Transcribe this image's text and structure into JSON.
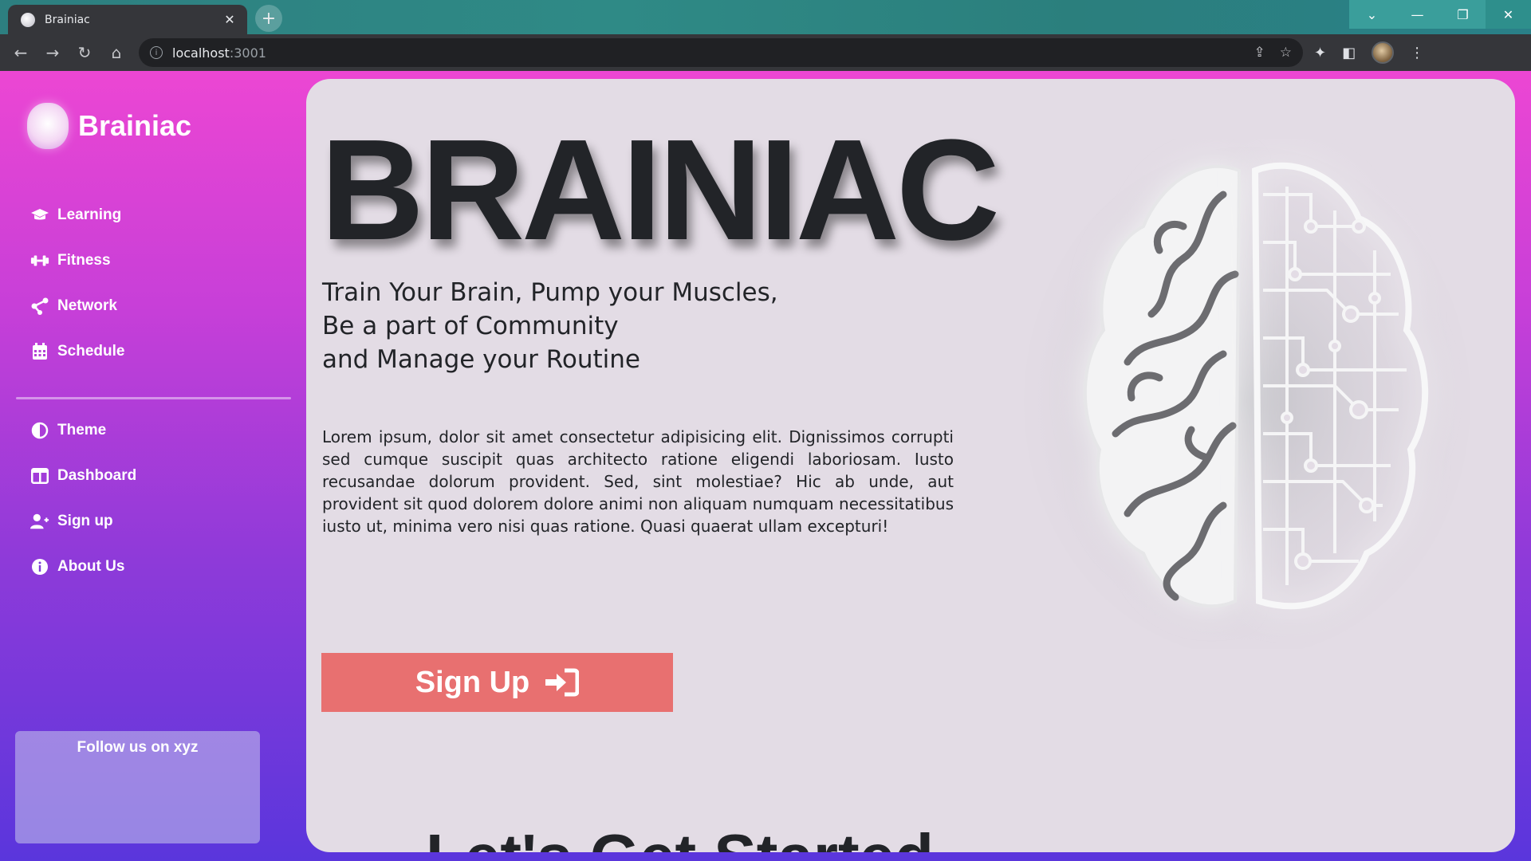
{
  "browser": {
    "tab_title": "Brainiac",
    "close_glyph": "✕",
    "newtab_glyph": "+",
    "url_host": "localhost",
    "url_port": ":3001",
    "window_controls": [
      "⌄",
      "—",
      "❐",
      "✕"
    ]
  },
  "brand": {
    "name": "Brainiac"
  },
  "nav_top": [
    {
      "label": "Learning",
      "icon": "graduation-cap-icon",
      "glyph": "🎓"
    },
    {
      "label": "Fitness",
      "icon": "dumbbell-icon",
      "glyph": "⚌"
    },
    {
      "label": "Network",
      "icon": "share-network-icon",
      "glyph": "⋖"
    },
    {
      "label": "Schedule",
      "icon": "calendar-icon",
      "glyph": "▦"
    }
  ],
  "nav_bottom": [
    {
      "label": "Theme",
      "icon": "theme-half-circle-icon",
      "glyph": "◐"
    },
    {
      "label": "Dashboard",
      "icon": "dashboard-columns-icon",
      "glyph": "◫"
    },
    {
      "label": "Sign up",
      "icon": "user-plus-icon",
      "glyph": "👤"
    },
    {
      "label": "About Us",
      "icon": "info-circle-icon",
      "glyph": "ℹ"
    }
  ],
  "follow": {
    "text": "Follow us on xyz"
  },
  "hero": {
    "title": "BRAINIAC",
    "subtitle_lines": [
      "Train Your Brain, Pump your Muscles,",
      "Be a part of Community",
      "and Manage your Routine"
    ],
    "lorem": "Lorem ipsum, dolor sit amet consectetur adipisicing elit. Dignissimos corrupti sed cumque suscipit quas architecto ratione eligendi laboriosam. Iusto recusandae dolorum provident. Sed, sint molestiae? Hic ab unde, aut provident sit quod dolorem dolore animi non aliquam numquam necessitatibus iusto ut, minima vero nisi quas ratione. Quasi quaerat ullam excepturi!",
    "cta_label": "Sign Up",
    "cta_icon": "sign-in-icon",
    "next_heading": "Let's Get Started"
  },
  "colors": {
    "sidebar_top": "#ec46d3",
    "sidebar_bottom": "#5a36dc",
    "panel": "#e3dce5",
    "cta": "#e87070",
    "title": "#222428"
  }
}
